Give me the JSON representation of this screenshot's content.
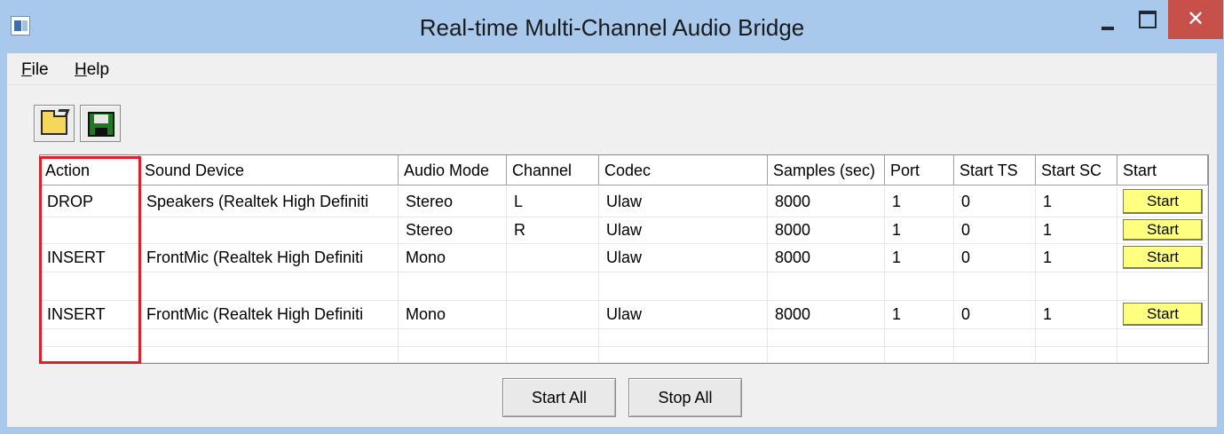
{
  "window": {
    "title": "Real-time Multi-Channel Audio Bridge",
    "close_glyph": "✕"
  },
  "menu": {
    "file_first": "F",
    "file_rest": "ile",
    "help_first": "H",
    "help_rest": "elp"
  },
  "toolbar": {
    "open_icon": "folder-open-icon",
    "save_icon": "floppy-disk-icon"
  },
  "table": {
    "headers": [
      "Action",
      "Sound Device",
      "Audio Mode",
      "Channel",
      "Codec",
      "Samples (sec)",
      "Port",
      "Start TS",
      "Start SC",
      "Start"
    ],
    "rows": [
      {
        "action": "DROP",
        "device": "Speakers (Realtek High Definiti",
        "mode": "Stereo",
        "channel": "L",
        "codec": "Ulaw",
        "samples": "8000",
        "port": "1",
        "start_ts": "0",
        "start_sc": "1",
        "start": "Start"
      },
      {
        "action": "",
        "device": "",
        "mode": "Stereo",
        "channel": "R",
        "codec": "Ulaw",
        "samples": "8000",
        "port": "1",
        "start_ts": "0",
        "start_sc": "1",
        "start": "Start"
      },
      {
        "action": "INSERT",
        "device": "FrontMic (Realtek High Definiti",
        "mode": "Mono",
        "channel": "",
        "codec": "Ulaw",
        "samples": "8000",
        "port": "1",
        "start_ts": "0",
        "start_sc": "1",
        "start": "Start"
      },
      {
        "action": "",
        "device": "",
        "mode": "",
        "channel": "",
        "codec": "",
        "samples": "",
        "port": "",
        "start_ts": "",
        "start_sc": "",
        "start": ""
      },
      {
        "action": "INSERT",
        "device": "FrontMic (Realtek High Definiti",
        "mode": "Mono",
        "channel": "",
        "codec": "Ulaw",
        "samples": "8000",
        "port": "1",
        "start_ts": "0",
        "start_sc": "1",
        "start": "Start"
      },
      {
        "action": "",
        "device": "",
        "mode": "",
        "channel": "",
        "codec": "",
        "samples": "",
        "port": "",
        "start_ts": "",
        "start_sc": "",
        "start": ""
      },
      {
        "action": "",
        "device": "",
        "mode": "",
        "channel": "",
        "codec": "",
        "samples": "",
        "port": "",
        "start_ts": "",
        "start_sc": "",
        "start": ""
      }
    ]
  },
  "buttons": {
    "start_all": "Start All",
    "stop_all": "Stop All"
  },
  "colors": {
    "title_bar": "#a9c9ec",
    "close_button": "#c7504b",
    "start_button": "#ffff80",
    "highlight_box": "#e01f2b"
  }
}
